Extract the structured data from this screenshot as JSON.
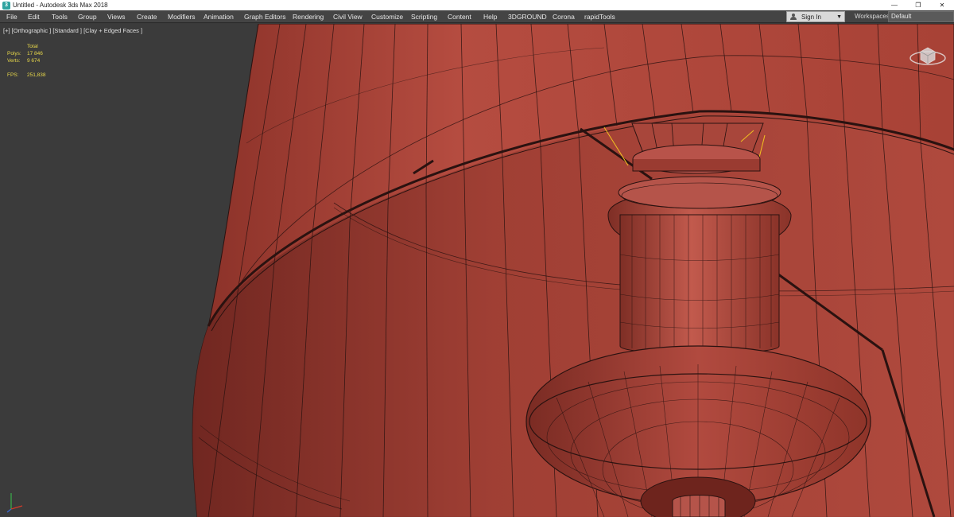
{
  "window": {
    "app_icon_glyph": "3",
    "title": "Untitled - Autodesk 3ds Max 2018",
    "minimize": "—",
    "maximize": "❐",
    "close": "✕"
  },
  "menu": {
    "items": [
      {
        "label": "File"
      },
      {
        "label": "Edit"
      },
      {
        "label": "Tools"
      },
      {
        "label": "Group"
      },
      {
        "label": "Views"
      },
      {
        "label": "Create"
      },
      {
        "label": "Modifiers"
      },
      {
        "label": "Animation"
      },
      {
        "label": "Graph Editors"
      },
      {
        "label": "Rendering"
      },
      {
        "label": "Civil View"
      },
      {
        "label": "Customize"
      },
      {
        "label": "Scripting"
      },
      {
        "label": "Content"
      },
      {
        "label": "Help"
      },
      {
        "label": "3DGROUND"
      },
      {
        "label": "Corona"
      },
      {
        "label": "rapidTools"
      }
    ]
  },
  "account": {
    "sign_in": "Sign In",
    "workspaces_label": "Workspaces:",
    "workspace": "Default"
  },
  "viewport": {
    "label": "[+] [Orthographic ] [Standard ] [Clay + Edged Faces ]",
    "stats": {
      "total_label": "Total",
      "polys_label": "Polys:",
      "polys_value": "17 846",
      "verts_label": "Verts:",
      "verts_value": "9 674",
      "fps_label": "FPS:",
      "fps_value": "251,838"
    }
  },
  "icons": {
    "viewcube": "viewcube-icon",
    "axis_tripod": "axis-tripod-icon",
    "user": "user-icon"
  },
  "colors": {
    "clay": "#b14a3f",
    "clay_dark": "#7a2a22",
    "clay_light": "#c96457",
    "wire": "#2a1210",
    "viewport_bg": "#3b3b3b",
    "menubar_bg": "#444444",
    "stats_text": "#e8d84a",
    "selection_highlight": "#f0c020"
  }
}
